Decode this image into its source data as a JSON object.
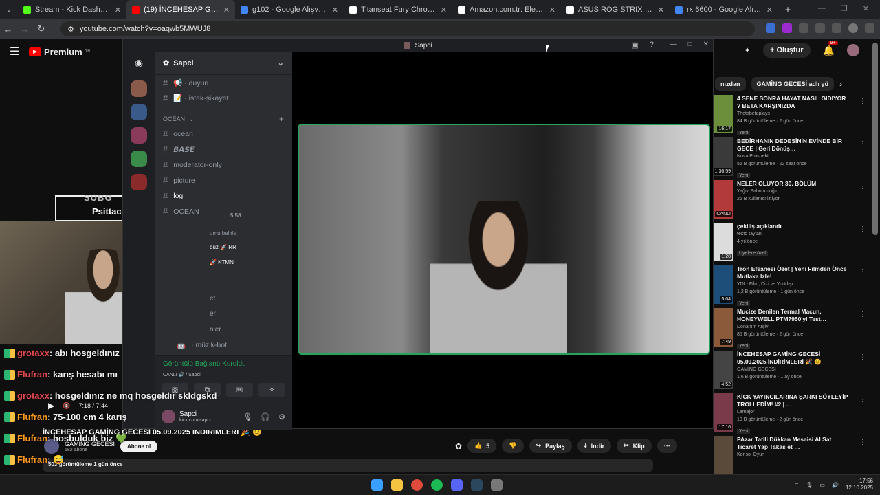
{
  "browser": {
    "tabs": [
      {
        "title": "Stream - Kick Dashboard",
        "color": "#53fc18"
      },
      {
        "title": "(19) İNCEHESAP GAMİNG GECE",
        "color": "#ff0000",
        "active": true
      },
      {
        "title": "g102 - Google Alışveriş",
        "color": "#4285f4"
      },
      {
        "title": "Titanseat Fury Chromium Kum",
        "color": "#ffffff"
      },
      {
        "title": "Amazon.com.tr: Elektronik, bilg",
        "color": "#ffffff"
      },
      {
        "title": "ASUS ROG STRIX XG27ACS 27",
        "color": "#ffffff"
      },
      {
        "title": "rx 6600 - Google Alışveriş",
        "color": "#4285f4"
      }
    ],
    "url": "youtube.com/watch?v=oaqwb5MWUJ8"
  },
  "youtube": {
    "logo": "Premium",
    "logo_region": "TR",
    "create": "Oluştur",
    "bell_badge": "9+",
    "chips": [
      "nızdan",
      "GAMİNG GECESİ adlı yü"
    ],
    "sidebar": [
      {
        "title": "4 SENE SONRA HAYAT NASIL GİDİYOR ? BETA KARŞINIZDA",
        "channel": "Thetabetaplays",
        "meta": "84 B görüntüleme · 2 gün önce",
        "badge": "Yeni",
        "dur": "16:17",
        "color": "#6b8f3a"
      },
      {
        "title": "BEDİRHANIN DEDESİNİN EVİNDE BİR GECE | Geri Dönüş…",
        "channel": "Nova Prospekt",
        "meta": "56 B görüntüleme · 22 saat önce",
        "badge": "Yeni",
        "dur": "1:30:59",
        "color": "#3a3a3a"
      },
      {
        "title": "NELER OLUYOR 30. BÖLÜM",
        "channel": "Yağız Sabuncuoğlu",
        "meta": "25 B kullanıcı izliyor",
        "badge": "",
        "dur": "CANLI",
        "color": "#b33a3a"
      },
      {
        "title": "çekiliş açıklandı",
        "channel": "testo taylan",
        "meta": "4 yıl önce",
        "badge": "Üyelere özel",
        "dur": "1:28",
        "color": "#dcdcdc"
      },
      {
        "title": "Tron Efsanesi Özet | Yeni Filmden Önce Mutlaka İzle!",
        "channel": "YDI - Film, Dizi ve Yurtdışı",
        "meta": "1,2 B görüntüleme · 1 gün önce",
        "badge": "Yeni",
        "dur": "5:04",
        "color": "#1d4e7a"
      },
      {
        "title": "Mucize Denilen Termal Macun, HONEYWELL PTM7950'yi Test…",
        "channel": "Donanım Arşivi",
        "meta": "85 B görüntüleme · 2 gün önce",
        "badge": "Yeni",
        "dur": "7:49",
        "color": "#8a5a3a"
      },
      {
        "title": "İNCEHESAP GAMİNG GECESİ 05.09.2025 İNDİRİMLERİ 🎉 😊",
        "channel": "GAMİNG GECESİ",
        "meta": "1,6 B görüntüleme · 1 ay önce",
        "badge": "",
        "dur": "4:52",
        "color": "#444"
      },
      {
        "title": "KİCK YAYINCILARINA ŞARKI SÖYLEYİP TROLLEDİM! #2 | …",
        "channel": "Lamajor",
        "meta": "10 B görüntüleme · 2 gün önce",
        "badge": "Yeni",
        "dur": "17:16",
        "color": "#7a3a4a"
      },
      {
        "title": "PAzar Tatili Dükkan Mesaisi Al Sat Ticaret Yap Takas et …",
        "channel": "Konsol Oyun",
        "meta": "",
        "badge": "",
        "dur": "",
        "color": "#5a4a3a"
      }
    ],
    "video_title": "İNCEHESAP GAMİNG GECESİ 05.09.2025 İNDİRİMLERİ 🎉 😊",
    "channel": {
      "name": "GAMİNG GECESİ",
      "subs": "682 abone",
      "subscribe": "Abone ol"
    },
    "actions": {
      "likes": "5",
      "share": "Paylaş",
      "download": "İndir",
      "clip": "Klip"
    },
    "desc": "503 görüntüleme  1 gün önce",
    "time": "7:18 / 7:44"
  },
  "discord": {
    "window_title": "Sapci",
    "server": "Sapci",
    "channels": [
      {
        "name": "📢 · duyuru",
        "type": "text"
      },
      {
        "name": "📝 · istek-şikayet",
        "type": "text"
      }
    ],
    "category": "OCEAN",
    "channels2": [
      {
        "name": "ocean",
        "bold": false
      },
      {
        "name": "𝘽𝘼𝙎𝙀",
        "bold": false
      },
      {
        "name": "moderator-only",
        "bold": false
      },
      {
        "name": "picture",
        "bold": false
      },
      {
        "name": "log",
        "bold": true
      },
      {
        "name": "OCEAN",
        "bold": false
      }
    ],
    "voice_time": "5:58",
    "hint": "umu belirle",
    "bot_channel": "· müzik-bot",
    "voice_status": "Görüntülü Bağlantı Kuruldu",
    "voice_sub": "CANLI 🔊 / Sapci",
    "user": "Sapci",
    "user_status": "kick.com/sapci",
    "stub_items": [
      "buz 🚀 RR",
      "🚀 KTMN",
      "et",
      "er",
      "nler"
    ]
  },
  "overlay": {
    "subg": "SUBG",
    "name": "Psittac",
    "chat": [
      {
        "user": "grotaxx",
        "msg": "abı hosgeldınız",
        "color": "red"
      },
      {
        "user": "Flufran",
        "msg": "karış hesabı mı",
        "color": "red"
      },
      {
        "user": "grotaxx",
        "msg": "hosgeldınız ne mq hosgeldır skldgskd",
        "color": "red"
      },
      {
        "user": "Flufran",
        "msg": "75-100 cm 4 karış",
        "color": "orange"
      },
      {
        "user": "Flufran",
        "msg": "hosbulduk biz 💚",
        "color": "orange"
      },
      {
        "user": "Flufran",
        "msg": "😅",
        "color": "orange"
      },
      {
        "user": "Flufran",
        "msg": "🙏🏻",
        "color": "orange"
      }
    ]
  },
  "taskbar": {
    "time": "17:56",
    "date": "12.10.2025"
  }
}
